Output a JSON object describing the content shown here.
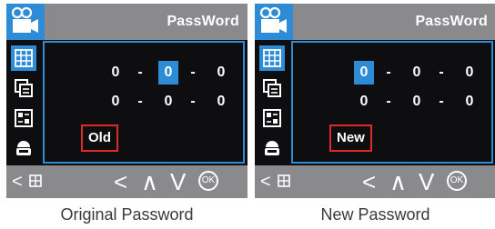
{
  "colors": {
    "accent": "#2e8bd6",
    "bar": "#8a8a8c",
    "screen_bg": "#0e0e10",
    "highlight_border": "#e02a2a",
    "text": "#ffffff"
  },
  "screens": [
    {
      "title": "PassWord",
      "rows": [
        {
          "digits": [
            "0",
            "0",
            "0"
          ],
          "selected_index": 1
        },
        {
          "digits": [
            "0",
            "0",
            "0"
          ],
          "selected_index": -1
        }
      ],
      "separator": "-",
      "tag": "Old",
      "caption": "Original Password"
    },
    {
      "title": "PassWord",
      "rows": [
        {
          "digits": [
            "0",
            "0",
            "0"
          ],
          "selected_index": 0
        },
        {
          "digits": [
            "0",
            "0",
            "0"
          ],
          "selected_index": -1
        }
      ],
      "separator": "-",
      "tag": "New",
      "caption": "New Password"
    }
  ],
  "bottom_bar": {
    "back": "<",
    "left_arrow": "<",
    "up_arrow": "∧",
    "down_arrow": "V",
    "ok": "OK"
  },
  "icons": {
    "top": "video-camera-icon",
    "sidebar": [
      "grid-menu-icon",
      "copy-document-icon",
      "image-frame-icon",
      "user-lock-icon"
    ],
    "bottom": [
      "back-menu-icon",
      "ok-button-icon"
    ]
  }
}
